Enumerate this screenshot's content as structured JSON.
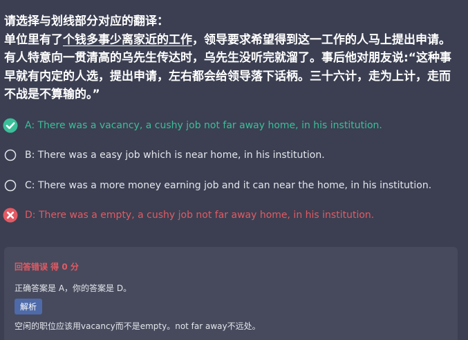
{
  "question": {
    "prompt": "请选择与划线部分对应的翻译：",
    "text_before": "单位里有了",
    "underlined": "个钱多事少离家近的工作",
    "text_after": "，领导要求希望得到这一工作的人马上提出申请。 有人特意向一贯清高的乌先生传达时，乌先生没听完就溜了。事后他对朋友说:“这种事早就有内定的人选，提出申请，左右都会给领导落下话柄。三十六计，走为上计，走而不战是不算输的。”"
  },
  "options": [
    {
      "label": "A: There was a vacancy, a cushy job not far away home, in his institution.",
      "state": "correct",
      "icon": "check-circle-icon"
    },
    {
      "label": "B: There was a easy job which is near home, in his institution.",
      "state": "neutral",
      "icon": "radio-empty-icon"
    },
    {
      "label": "C: There was a more money earning job and it can near the home, in his institution.",
      "state": "neutral",
      "icon": "radio-empty-icon"
    },
    {
      "label": "D: There was a empty, a cushy job not far away home, in his institution.",
      "state": "wrong",
      "icon": "x-circle-icon"
    }
  ],
  "feedback": {
    "result": "回答错误 得 0 分",
    "answer_line": "正确答案是 A，你的答案是 D。",
    "explain_button": "解析",
    "explanation": "空闲的职位应该用vacancy而不是empty。not far away不远处。"
  },
  "colors": {
    "background": "#3b3f51",
    "panel": "#464a5c",
    "correct": "#3bbf99",
    "wrong": "#e35a64",
    "button": "#4e6aa8"
  }
}
